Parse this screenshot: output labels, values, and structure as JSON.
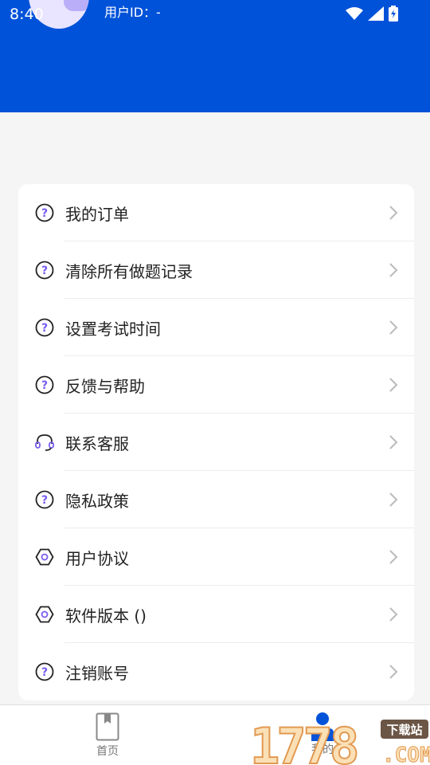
{
  "status": {
    "time": "8:40"
  },
  "header": {
    "user_id": "用户ID：-",
    "bg_color": "#0052d9"
  },
  "menu": [
    {
      "label": "我的订单",
      "icon": "question-circle-icon"
    },
    {
      "label": "清除所有做题记录",
      "icon": "question-circle-icon"
    },
    {
      "label": "设置考试时间",
      "icon": "question-circle-icon"
    },
    {
      "label": "反馈与帮助",
      "icon": "question-circle-icon"
    },
    {
      "label": "联系客服",
      "icon": "headset-icon"
    },
    {
      "label": "隐私政策",
      "icon": "question-circle-icon"
    },
    {
      "label": "用户协议",
      "icon": "hexagon-icon"
    },
    {
      "label": "软件版本 ()",
      "icon": "hexagon-icon"
    },
    {
      "label": "注销账号",
      "icon": "question-circle-icon"
    }
  ],
  "tabbar": {
    "home_label": "首页",
    "mine_label": "我的",
    "active_color": "#0052d9"
  },
  "watermark": {
    "text": "1778",
    "badge": "下载站",
    "domain": ".COM"
  }
}
